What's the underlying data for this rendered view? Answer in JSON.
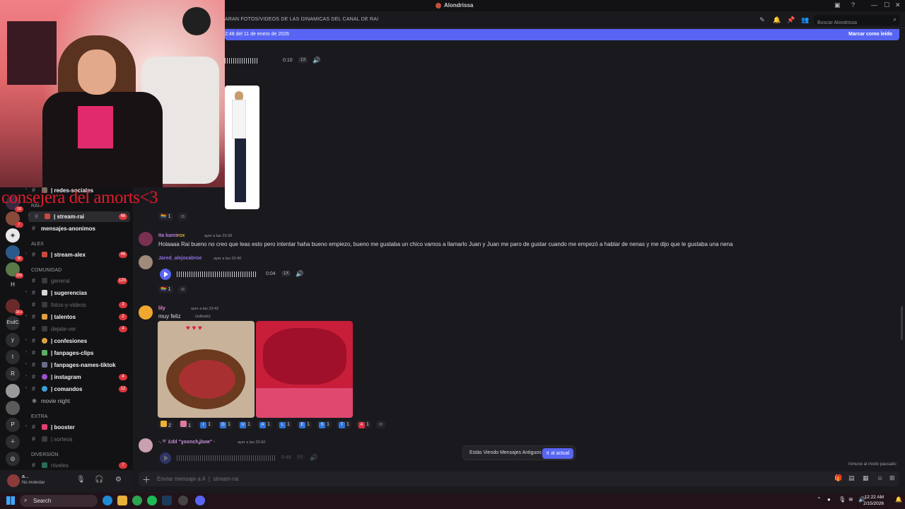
{
  "app": {
    "title": "Alondrissa"
  },
  "header": {
    "topic": "ARAN FOTOS/VIDEOS DE LAS DINAMICAS DEL CANAL DE RAI",
    "search_placeholder": "Buscar Alondrissa"
  },
  "new_messages_bar": {
    "since": "2:48 del 11 de enero de 2026",
    "mark_read": "Marcar como leído"
  },
  "stream_overlay": {
    "caption": "consejera del amorts<3"
  },
  "rail": {
    "badges": [
      "18",
      "7",
      "30",
      "326",
      "1K+"
    ],
    "labels": [
      "H",
      "EsdC",
      "y",
      "t",
      "R",
      "P"
    ]
  },
  "sidebar": {
    "categories": {
      "rai": "RAI",
      "alex": "ALEX",
      "comunidad": "COMUNIDAD",
      "extra": "EXTRA",
      "diversion": "DIVERSIÓN"
    },
    "channels": [
      {
        "name": "| redes-sociales",
        "badge": ""
      },
      {
        "name": "| stream-rai",
        "badge": "66"
      },
      {
        "name": "mensajes-anonimos",
        "badge": ""
      },
      {
        "name": "| stream-alex",
        "badge": "46"
      },
      {
        "name": "general",
        "badge": "120"
      },
      {
        "name": "| sugerencias",
        "badge": ""
      },
      {
        "name": "fotos-y-videos",
        "badge": "3"
      },
      {
        "name": "| talentos",
        "badge": "2"
      },
      {
        "name": "dejate-ver",
        "badge": "4"
      },
      {
        "name": "| confesiones",
        "badge": ""
      },
      {
        "name": "| fanpages-clips",
        "badge": ""
      },
      {
        "name": "| fanpages-names-tiktok",
        "badge": ""
      },
      {
        "name": "| instagram",
        "badge": "4"
      },
      {
        "name": "| comandos",
        "badge": "12"
      },
      {
        "name": "movie night",
        "badge": ""
      },
      {
        "name": "| booster",
        "badge": ""
      },
      {
        "name": "| sorteos",
        "badge": ""
      },
      {
        "name": "niveles",
        "badge": "7"
      }
    ]
  },
  "user_panel": {
    "name": "a...",
    "status": "No molestar"
  },
  "messages": {
    "audio1": {
      "duration": "0:10",
      "speed": "1X"
    },
    "reaction_count_1": "1",
    "m1": {
      "user": "Ita kami",
      "tag": "FOX",
      "time": "ayer a las 23:39",
      "text": "Holaaaa Rai bueno no creo que leas esto pero intentar haha bueno empiezo, bueno me gustaba un chico vamos a llamarlo Juan y Juan me paro de gustar cuando me empezó a hablar de nenas y me dijo que le gustaba una nena"
    },
    "m2": {
      "user": "Jared_alejocabroe",
      "time": "ayer a las 23:40",
      "duration": "0:04",
      "speed": "1X",
      "reaction_count": "1"
    },
    "m3": {
      "user": "lily",
      "time": "ayer a las 23:42",
      "edited": "(editado)",
      "text": "muy feliz",
      "reactions": [
        {
          "label": "2",
          "icon": ""
        },
        {
          "label": "1",
          "icon": ""
        },
        {
          "label": "1",
          "icon": "I"
        },
        {
          "label": "1",
          "icon": "G"
        },
        {
          "label": "1",
          "icon": "U"
        },
        {
          "label": "1",
          "icon": "A"
        },
        {
          "label": "1",
          "icon": "L"
        },
        {
          "label": "1",
          "icon": "E"
        },
        {
          "label": "1",
          "icon": "S"
        },
        {
          "label": "1",
          "icon": "T"
        },
        {
          "label": "1",
          "icon": "A"
        }
      ]
    },
    "m4": {
      "user": "·. ʰˡ˙ £dd \"ɣoonchʝbɑɵ\" ·",
      "time": "ayer a las 23:42",
      "duration": "0:49",
      "speed": "1X"
    }
  },
  "old_messages": {
    "text": "Estás Viendo Mensajes Antiguos",
    "button": "Ir al actual"
  },
  "immune": "Inmune al modo pausado",
  "composer": {
    "placeholder": "Enviar mensaje a #  |  stream-rai"
  },
  "taskbar": {
    "search": "Search",
    "time": "12:22 AM",
    "date": "2/15/2026"
  },
  "colors": {
    "accent": "#5865f2",
    "badge": "#da373c",
    "bg": "#1a1a1e",
    "sidebar": "#121214"
  }
}
